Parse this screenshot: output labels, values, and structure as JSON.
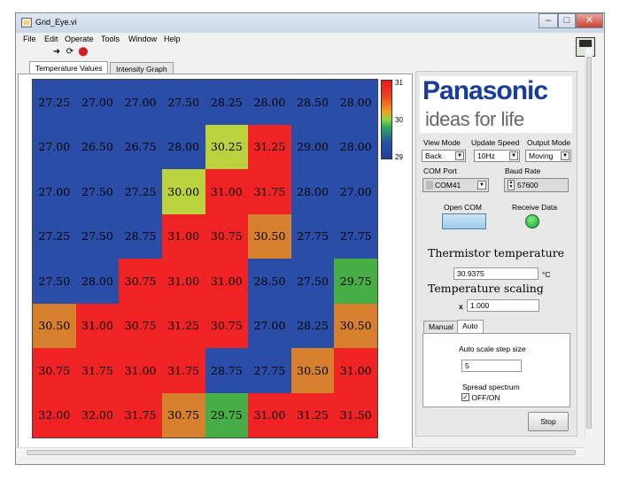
{
  "window": {
    "title": "Grid_Eye.vi"
  },
  "menu": [
    "File",
    "Edit",
    "Operate",
    "Tools",
    "Window",
    "Help"
  ],
  "tabs": [
    "Temperature Values",
    "Intensity Graph"
  ],
  "scale": {
    "max": "31",
    "mid": "30",
    "min": "29"
  },
  "colors": {
    "hot": "#ef2323",
    "warm": "#d67f2c",
    "mid": "#b9d23d",
    "cool": "#47ad45",
    "cold": "#2a4ea7"
  },
  "grid": [
    [
      "27.25",
      "27.00",
      "27.00",
      "27.50",
      "28.25",
      "28.00",
      "28.50",
      "28.00"
    ],
    [
      "27.00",
      "26.50",
      "26.75",
      "28.00",
      "30.25",
      "31.25",
      "29.00",
      "28.00"
    ],
    [
      "27.00",
      "27.50",
      "27.25",
      "30.00",
      "31.00",
      "31.75",
      "28.00",
      "27.00"
    ],
    [
      "27.25",
      "27.50",
      "28.75",
      "31.00",
      "30.75",
      "30.50",
      "27.75",
      "27.75"
    ],
    [
      "27.50",
      "28.00",
      "30.75",
      "31.00",
      "31.00",
      "28.50",
      "27.50",
      "29.75"
    ],
    [
      "30.50",
      "31.00",
      "30.75",
      "31.25",
      "30.75",
      "27.00",
      "28.25",
      "30.50"
    ],
    [
      "30.75",
      "31.75",
      "31.00",
      "31.75",
      "28.75",
      "27.75",
      "30.50",
      "31.00"
    ],
    [
      "32.00",
      "32.00",
      "31.75",
      "30.75",
      "29.75",
      "31.00",
      "31.25",
      "31.50"
    ]
  ],
  "grid_colors": [
    [
      "cold",
      "cold",
      "cold",
      "cold",
      "cold",
      "cold",
      "cold",
      "cold"
    ],
    [
      "cold",
      "cold",
      "cold",
      "cold",
      "mid",
      "hot",
      "cold",
      "cold"
    ],
    [
      "cold",
      "cold",
      "cold",
      "mid",
      "hot",
      "hot",
      "cold",
      "cold"
    ],
    [
      "cold",
      "cold",
      "cold",
      "hot",
      "hot",
      "warm",
      "cold",
      "cold"
    ],
    [
      "cold",
      "cold",
      "hot",
      "hot",
      "hot",
      "cold",
      "cold",
      "cool"
    ],
    [
      "warm",
      "hot",
      "hot",
      "hot",
      "hot",
      "cold",
      "cold",
      "warm"
    ],
    [
      "hot",
      "hot",
      "hot",
      "hot",
      "cold",
      "cold",
      "warm",
      "hot"
    ],
    [
      "hot",
      "hot",
      "hot",
      "warm",
      "cool",
      "hot",
      "hot",
      "hot"
    ]
  ],
  "brand": {
    "name": "Panasonic",
    "tagline": "ideas for life"
  },
  "controls": {
    "view_mode_label": "View Mode",
    "view_mode": "Back",
    "update_speed_label": "Update Speed",
    "update_speed": "10Hz",
    "output_mode_label": "Output Mode",
    "output_mode": "Moving",
    "com_port_label": "COM Port",
    "com_port": "COM41",
    "baud_rate_label": "Baud Rate",
    "baud_rate": "57600",
    "open_com_label": "Open COM",
    "receive_data_label": "Receive Data",
    "thermistor_label": "Thermistor temperature",
    "thermistor_value": "30.9375",
    "thermistor_unit": "°C",
    "scaling_label": "Temperature scaling",
    "scaling_prefix": "x",
    "scaling_value": "1.000",
    "subtabs": [
      "Manual",
      "Auto"
    ],
    "auto_step_label": "Auto scale step size",
    "auto_step_value": "5",
    "spread_label": "Spread spectrum",
    "spread_toggle_label": "OFF/ON",
    "stop_label": "Stop"
  }
}
